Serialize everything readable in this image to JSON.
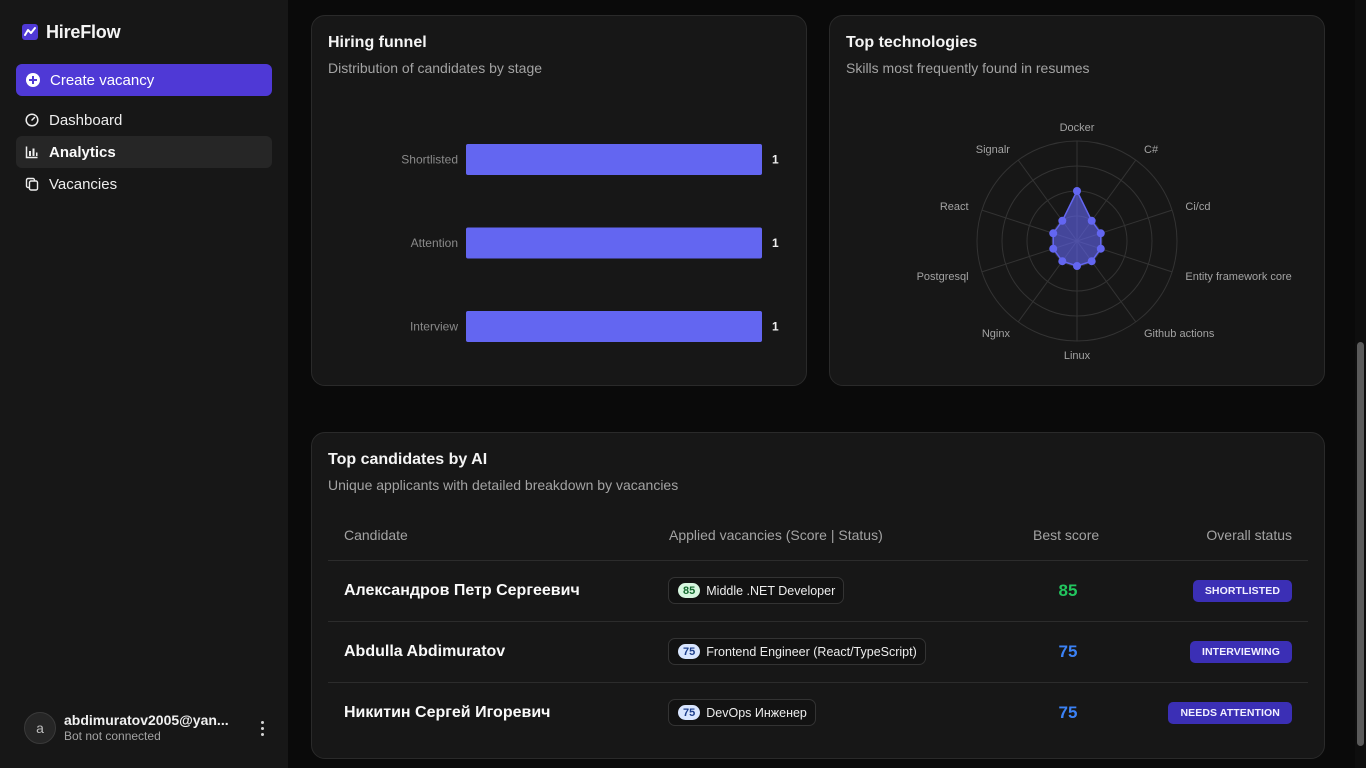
{
  "sidebar": {
    "brand": "HireFlow",
    "create_label": "Create vacancy",
    "nav": [
      {
        "label": "Dashboard",
        "icon": "gauge-icon"
      },
      {
        "label": "Analytics",
        "icon": "bar-chart-icon"
      },
      {
        "label": "Vacancies",
        "icon": "copy-icon"
      }
    ],
    "user": {
      "initial": "a",
      "email": "abdimuratov2005@yan...",
      "status": "Bot not connected"
    }
  },
  "funnel": {
    "title": "Hiring funnel",
    "subtitle": "Distribution of candidates by stage",
    "chart_data": {
      "type": "bar",
      "orientation": "horizontal",
      "categories": [
        "Shortlisted",
        "Attention",
        "Interview"
      ],
      "values": [
        1,
        1,
        1
      ],
      "xlim": [
        0,
        1
      ],
      "grid": false,
      "color": "#6366f1"
    }
  },
  "tech": {
    "title": "Top technologies",
    "subtitle": "Skills most frequently found in resumes",
    "chart_data": {
      "type": "radar",
      "categories": [
        "Docker",
        "C#",
        "Ci/cd",
        "Entity framework core",
        "Github actions",
        "Linux",
        "Nginx",
        "Postgresql",
        "React",
        "Signalr"
      ],
      "values": [
        2,
        1,
        1,
        1,
        1,
        1,
        1,
        1,
        1,
        1
      ],
      "rlim": [
        0,
        4
      ],
      "grid": true,
      "color": "#6366f1"
    }
  },
  "candidates": {
    "title": "Top candidates by AI",
    "subtitle": "Unique applicants with detailed breakdown by vacancies",
    "columns": [
      "Candidate",
      "Applied vacancies (Score | Status)",
      "Best score",
      "Overall status"
    ],
    "rows": [
      {
        "name": "Александров Петр Сергеевич",
        "vac_score": "85",
        "vac_title": "Middle .NET Developer",
        "best": "85",
        "status": "SHORTLISTED",
        "tone": "green"
      },
      {
        "name": "Abdulla Abdimuratov",
        "vac_score": "75",
        "vac_title": "Frontend Engineer (React/TypeScript)",
        "best": "75",
        "status": "INTERVIEWING",
        "tone": "blue"
      },
      {
        "name": "Никитин Сергей Игоревич",
        "vac_score": "75",
        "vac_title": "DevOps Инженер",
        "best": "75",
        "status": "NEEDS ATTENTION",
        "tone": "blue"
      }
    ]
  },
  "colors": {
    "accent": "#4f39d6",
    "bar": "#6366f1",
    "score_green": "#22c55e",
    "score_blue": "#3b82f6",
    "badge": "#3b2fb5"
  }
}
